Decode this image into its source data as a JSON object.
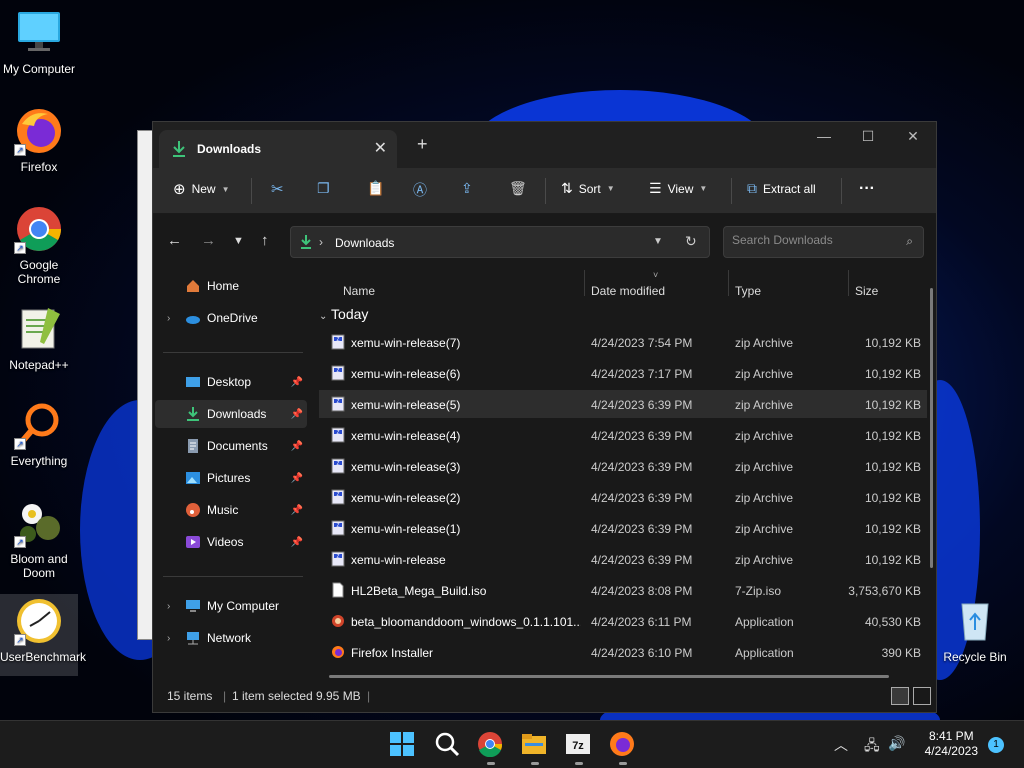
{
  "desktop": {
    "icons": [
      {
        "label": "My Computer"
      },
      {
        "label": "Firefox"
      },
      {
        "label": "Google Chrome"
      },
      {
        "label": "Notepad++"
      },
      {
        "label": "Everything"
      },
      {
        "label": "Bloom and Doom"
      },
      {
        "label": "UserBenchmark"
      },
      {
        "label": "Recycle Bin"
      }
    ]
  },
  "explorer": {
    "tab_title": "Downloads",
    "toolbar": {
      "new_label": "New",
      "sort_label": "Sort",
      "view_label": "View",
      "extract_label": "Extract all"
    },
    "address": {
      "path_label": "Downloads",
      "search_placeholder": "Search Downloads"
    },
    "sidebar": {
      "items": [
        {
          "label": "Home"
        },
        {
          "label": "OneDrive"
        },
        {
          "label": "Desktop"
        },
        {
          "label": "Downloads"
        },
        {
          "label": "Documents"
        },
        {
          "label": "Pictures"
        },
        {
          "label": "Music"
        },
        {
          "label": "Videos"
        },
        {
          "label": "My Computer"
        },
        {
          "label": "Network"
        }
      ]
    },
    "columns": {
      "name": "Name",
      "date": "Date modified",
      "type": "Type",
      "size": "Size"
    },
    "group_label": "Today",
    "files": [
      {
        "name": "xemu-win-release(7)",
        "date": "4/24/2023 7:54 PM",
        "type": "zip Archive",
        "size": "10,192 KB"
      },
      {
        "name": "xemu-win-release(6)",
        "date": "4/24/2023 7:17 PM",
        "type": "zip Archive",
        "size": "10,192 KB"
      },
      {
        "name": "xemu-win-release(5)",
        "date": "4/24/2023 6:39 PM",
        "type": "zip Archive",
        "size": "10,192 KB"
      },
      {
        "name": "xemu-win-release(4)",
        "date": "4/24/2023 6:39 PM",
        "type": "zip Archive",
        "size": "10,192 KB"
      },
      {
        "name": "xemu-win-release(3)",
        "date": "4/24/2023 6:39 PM",
        "type": "zip Archive",
        "size": "10,192 KB"
      },
      {
        "name": "xemu-win-release(2)",
        "date": "4/24/2023 6:39 PM",
        "type": "zip Archive",
        "size": "10,192 KB"
      },
      {
        "name": "xemu-win-release(1)",
        "date": "4/24/2023 6:39 PM",
        "type": "zip Archive",
        "size": "10,192 KB"
      },
      {
        "name": "xemu-win-release",
        "date": "4/24/2023 6:39 PM",
        "type": "zip Archive",
        "size": "10,192 KB"
      },
      {
        "name": "HL2Beta_Mega_Build.iso",
        "date": "4/24/2023 8:08 PM",
        "type": "7-Zip.iso",
        "size": "3,753,670 KB"
      },
      {
        "name": "beta_bloomanddoom_windows_0.1.1.101...",
        "date": "4/24/2023 6:11 PM",
        "type": "Application",
        "size": "40,530 KB"
      },
      {
        "name": "Firefox Installer",
        "date": "4/24/2023 6:10 PM",
        "type": "Application",
        "size": "390 KB"
      }
    ],
    "status": {
      "items": "15 items",
      "selected": "1 item selected",
      "size": "9.95 MB"
    }
  },
  "taskbar": {
    "time": "8:41 PM",
    "date": "4/24/2023",
    "notification_count": "1"
  },
  "colors": {
    "accent": "#4cc2ff",
    "download_green": "#3ec47a",
    "window_bg": "#191919"
  }
}
